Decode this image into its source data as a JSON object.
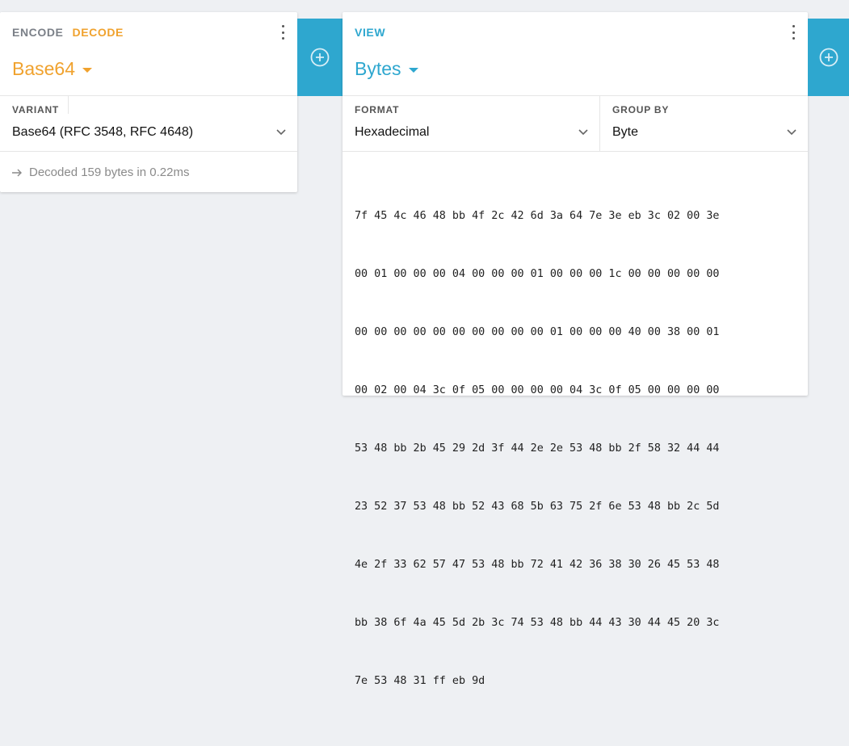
{
  "encoder": {
    "tabs": [
      "ENCODE",
      "DECODE"
    ],
    "active_tab": "DECODE",
    "codec": "Base64",
    "variant_label": "VARIANT",
    "variant_value": "Base64 (RFC 3548, RFC 4648)",
    "status": "Decoded 159 bytes in 0.22ms",
    "accent_color": "#f0a22e"
  },
  "view": {
    "tab": "VIEW",
    "mode": "Bytes",
    "format_label": "FORMAT",
    "format_value": "Hexadecimal",
    "group_label": "GROUP BY",
    "group_value": "Byte",
    "accent_color": "#2ea7cf",
    "hex_lines": [
      "7f 45 4c 46 48 bb 4f 2c 42 6d 3a 64 7e 3e eb 3c 02 00 3e",
      "00 01 00 00 00 04 00 00 00 01 00 00 00 1c 00 00 00 00 00",
      "00 00 00 00 00 00 00 00 00 00 01 00 00 00 40 00 38 00 01",
      "00 02 00 04 3c 0f 05 00 00 00 00 04 3c 0f 05 00 00 00 00",
      "53 48 bb 2b 45 29 2d 3f 44 2e 2e 53 48 bb 2f 58 32 44 44",
      "23 52 37 53 48 bb 52 43 68 5b 63 75 2f 6e 53 48 bb 2c 5d",
      "4e 2f 33 62 57 47 53 48 bb 72 41 42 36 38 30 26 45 53 48",
      "bb 38 6f 4a 45 5d 2b 3c 74 53 48 bb 44 43 30 44 45 20 3c",
      "7e 53 48 31 ff eb 9d"
    ]
  },
  "icons": {
    "add_brick": "add-circle-icon",
    "menu": "more-vertical-icon",
    "dropdown": "chevron-down-icon",
    "status_arrow": "arrow-right-icon"
  }
}
